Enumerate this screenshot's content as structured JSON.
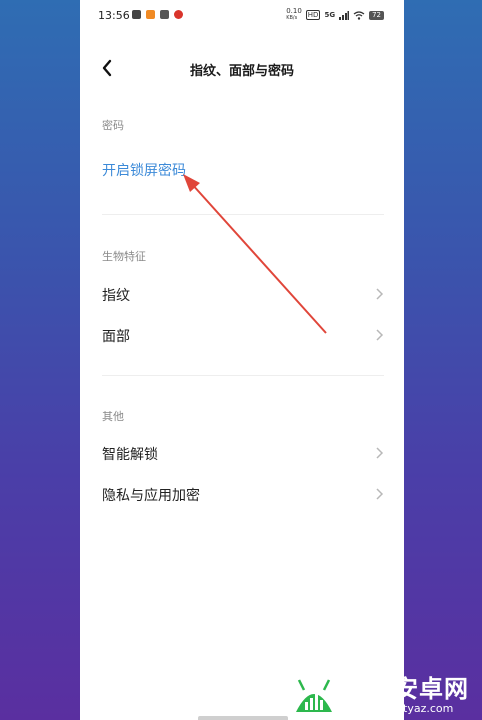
{
  "status_bar": {
    "time": "13:56",
    "net_speed": "0.10",
    "net_unit": "KB/s",
    "hd_badge": "HD",
    "signal": "5G",
    "battery": "72"
  },
  "header": {
    "back_icon": "chevron-left-icon",
    "title": "指纹、面部与密码"
  },
  "sections": {
    "password": {
      "label": "密码",
      "item": "开启锁屏密码"
    },
    "biometrics": {
      "label": "生物特征",
      "items": [
        "指纹",
        "面部"
      ]
    },
    "other": {
      "label": "其他",
      "items": [
        "智能解锁",
        "隐私与应用加密"
      ]
    }
  },
  "watermark": {
    "title": "天源安卓网",
    "url": "www.jytyaz.com"
  },
  "colors": {
    "link": "#3c8ad8",
    "arrow": "#e0463a",
    "background_top": "#2f6db3",
    "background_bottom": "#5a2fa0",
    "watermark_logo": "#2db84d"
  }
}
